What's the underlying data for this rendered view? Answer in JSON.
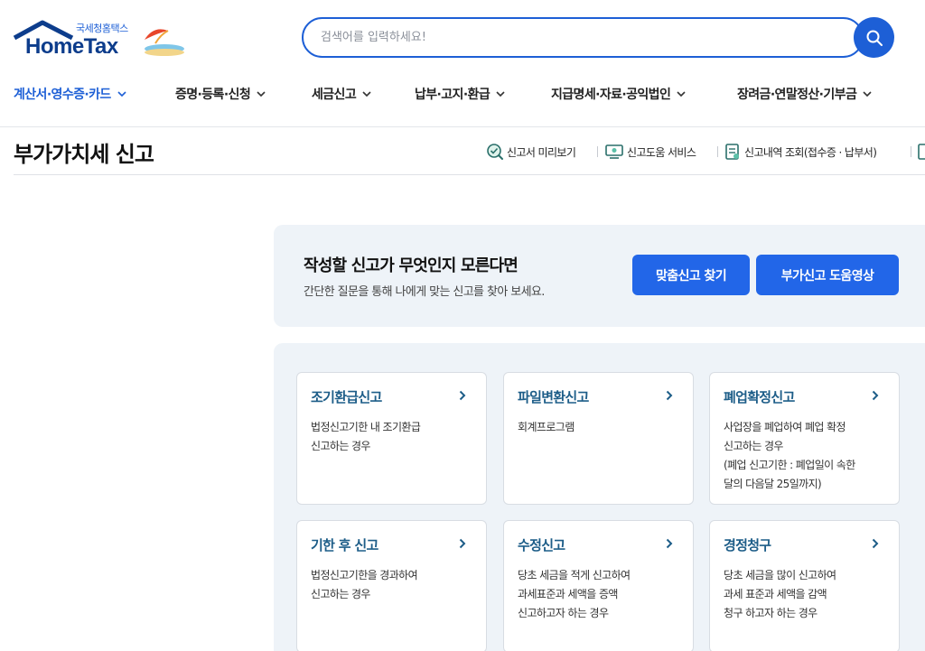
{
  "header": {
    "logo": {
      "sub": "국세청홈택스",
      "main": "HomeTax"
    },
    "search": {
      "placeholder": "검색어를 입력하세요!"
    }
  },
  "nav": [
    {
      "label": "계산서·영수증·카드",
      "active": true
    },
    {
      "label": "증명·등록·신청",
      "active": false
    },
    {
      "label": "세금신고",
      "active": false
    },
    {
      "label": "납부·고지·환급",
      "active": false
    },
    {
      "label": "지급명세·자료·공익법인",
      "active": false
    },
    {
      "label": "장려금·연말정산·기부금",
      "active": false
    }
  ],
  "page": {
    "title": "부가가치세 신고",
    "utils": [
      {
        "label": "신고서 미리보기",
        "icon": "search-doc-icon"
      },
      {
        "label": "신고도움 서비스",
        "icon": "monitor-icon"
      },
      {
        "label": "신고내역 조회(접수증 · 납부서)",
        "icon": "document-list-icon"
      }
    ]
  },
  "guide": {
    "title": "작성할 신고가 무엇인지 모른다면",
    "desc": "간단한 질문을 통해 나에게 맞는 신고를 찾아 보세요.",
    "btn_find": "맞춤신고 찾기",
    "btn_video": "부가신고 도움영상"
  },
  "cards": [
    {
      "title": "조기환급신고",
      "lines": [
        "법정신고기한 내 조기환급",
        "신고하는 경우"
      ]
    },
    {
      "title": "파일변환신고",
      "lines": [
        "회계프로그램"
      ]
    },
    {
      "title": "폐업확정신고",
      "lines": [
        "사업장을 폐업하여 폐업 확정",
        "신고하는 경우",
        "(폐업 신고기한 : 폐업일이 속한",
        "달의 다음달 25일까지)"
      ]
    },
    {
      "title": "기한 후 신고",
      "lines": [
        "법정신고기한을 경과하여",
        "신고하는 경우"
      ]
    },
    {
      "title": "수정신고",
      "lines": [
        "당초 세금을 적게 신고하여",
        "과세표준과 세액을 증액",
        "신고하고자 하는 경우"
      ]
    },
    {
      "title": "경정청구",
      "lines": [
        "당초 세금을 많이 신고하여",
        "과세 표준과 세액을 감액",
        "청구 하고자 하는 경우"
      ]
    }
  ],
  "colors": {
    "primary": "#1d5fd6",
    "button": "#2266e8",
    "card_title": "#1d5d88",
    "panel_bg": "#eef3f8"
  }
}
